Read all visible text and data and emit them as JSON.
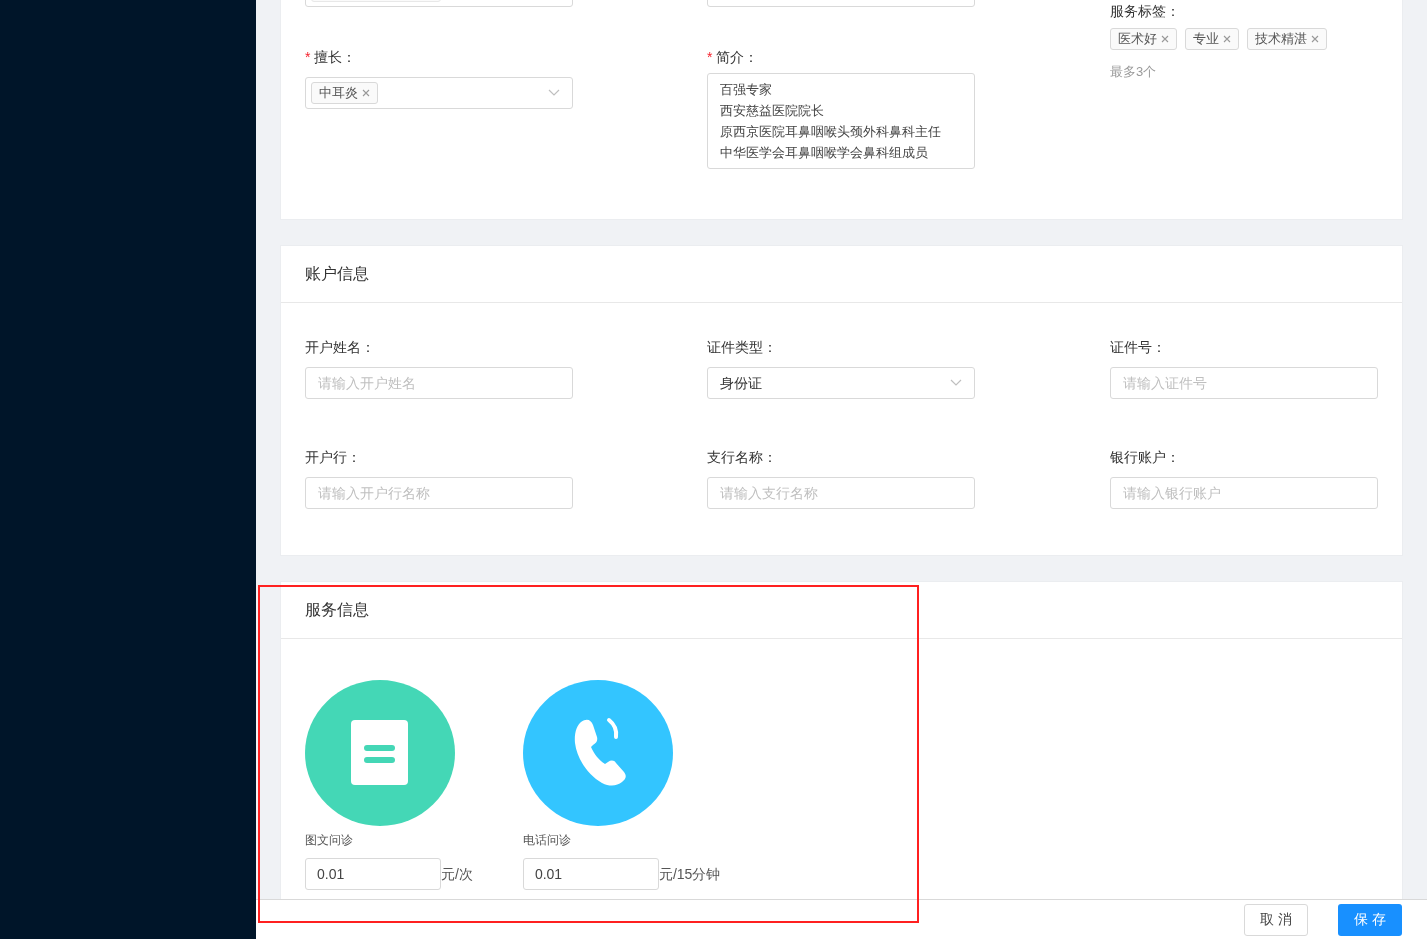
{
  "profile": {
    "expertise": {
      "label": "擅长：",
      "required_mark": "*",
      "tags": [
        "中耳炎"
      ]
    },
    "intro": {
      "label": "简介：",
      "required_mark": "*",
      "lines": [
        "百强专家",
        "西安慈益医院院长",
        "原西京医院耳鼻咽喉头颈外科鼻科主任",
        "中华医学会耳鼻咽喉学会鼻科组成员"
      ]
    },
    "service_tags": {
      "label": "服务标签：",
      "tags": [
        "医术好",
        "专业",
        "技术精湛"
      ],
      "hint": "最多3个"
    }
  },
  "account": {
    "title": "账户信息",
    "fields": [
      {
        "label": "开户姓名：",
        "kind": "input",
        "placeholder": "请输入开户姓名"
      },
      {
        "label": "证件类型：",
        "kind": "select",
        "value": "身份证"
      },
      {
        "label": "证件号：",
        "kind": "input",
        "placeholder": "请输入证件号"
      },
      {
        "label": "开户行：",
        "kind": "input",
        "placeholder": "请输入开户行名称"
      },
      {
        "label": "支行名称：",
        "kind": "input",
        "placeholder": "请输入支行名称"
      },
      {
        "label": "银行账户：",
        "kind": "input",
        "placeholder": "请输入银行账户"
      }
    ]
  },
  "service": {
    "title": "服务信息",
    "items": [
      {
        "name": "图文问诊",
        "kind": "document",
        "color": "#44d7b6",
        "price": "0.01",
        "unit": "元/次"
      },
      {
        "name": "电话问诊",
        "kind": "phone",
        "color": "#33c5ff",
        "price": "0.01",
        "unit": "元/15分钟"
      }
    ]
  },
  "footer": {
    "buttons": [
      {
        "label": "取消",
        "kind": "default"
      },
      {
        "label": "保存",
        "kind": "primary"
      }
    ]
  }
}
